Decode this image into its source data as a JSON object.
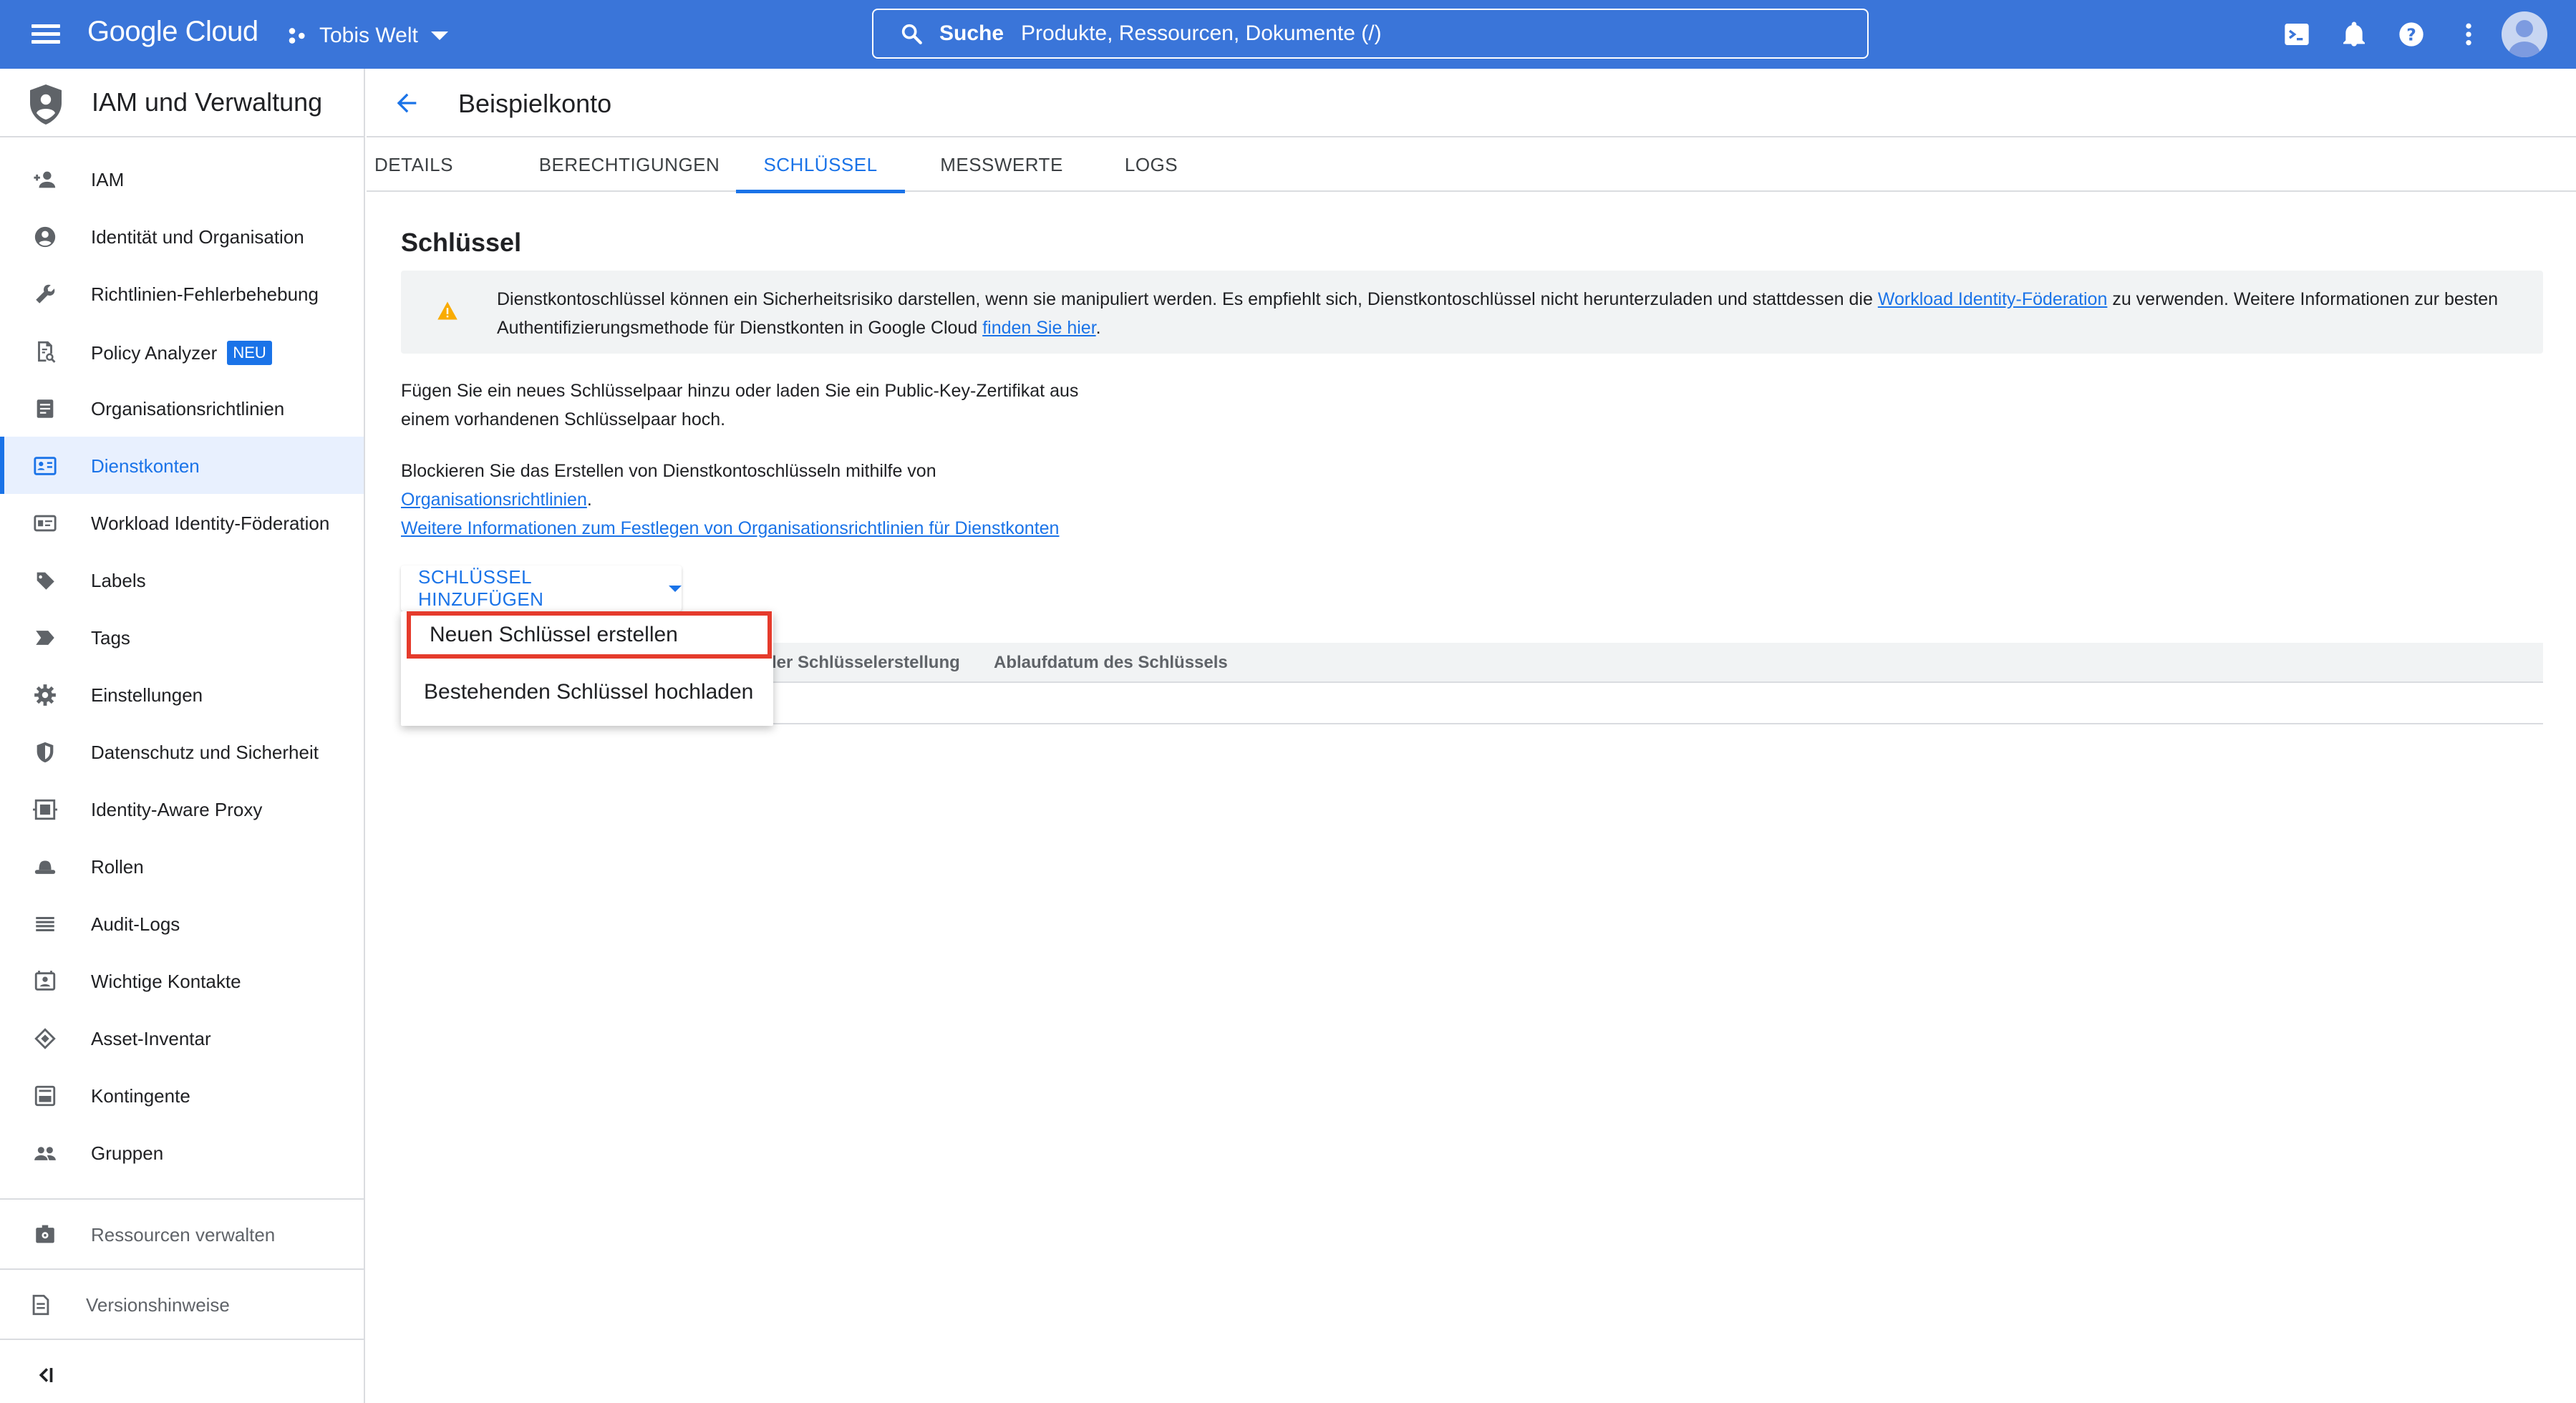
{
  "topbar": {
    "logo": "Google Cloud",
    "project": "Tobis Welt",
    "search_label": "Suche",
    "search_placeholder": "Produkte, Ressourcen, Dokumente (/)"
  },
  "sidebar": {
    "title": "IAM und Verwaltung",
    "items": [
      {
        "label": "IAM",
        "icon": "person-add-icon"
      },
      {
        "label": "Identität und Organisation",
        "icon": "account-circle-icon"
      },
      {
        "label": "Richtlinien-Fehlerbehebung",
        "icon": "wrench-icon"
      },
      {
        "label": "Policy Analyzer",
        "icon": "document-search-icon",
        "badge": "NEU"
      },
      {
        "label": "Organisationsrichtlinien",
        "icon": "list-document-icon"
      },
      {
        "label": "Dienstkonten",
        "icon": "service-account-icon",
        "active": true
      },
      {
        "label": "Workload Identity-Föderation",
        "icon": "id-card-icon"
      },
      {
        "label": "Labels",
        "icon": "label-icon"
      },
      {
        "label": "Tags",
        "icon": "tag-arrow-icon"
      },
      {
        "label": "Einstellungen",
        "icon": "gear-icon"
      },
      {
        "label": "Datenschutz und Sicherheit",
        "icon": "shield-icon"
      },
      {
        "label": "Identity-Aware Proxy",
        "icon": "proxy-icon"
      },
      {
        "label": "Rollen",
        "icon": "hat-icon"
      },
      {
        "label": "Audit-Logs",
        "icon": "lines-icon"
      },
      {
        "label": "Wichtige Kontakte",
        "icon": "contact-card-icon"
      },
      {
        "label": "Asset-Inventar",
        "icon": "layers-icon"
      },
      {
        "label": "Kontingente",
        "icon": "quota-icon"
      },
      {
        "label": "Gruppen",
        "icon": "group-icon"
      }
    ],
    "bottom": {
      "manage_resources": "Ressourcen verwalten",
      "release_notes": "Versionshinweise"
    }
  },
  "header": {
    "title": "Beispielkonto"
  },
  "tabs": [
    "DETAILS",
    "BERECHTIGUNGEN",
    "SCHLÜSSEL",
    "MESSWERTE",
    "LOGS"
  ],
  "active_tab": "SCHLÜSSEL",
  "keys": {
    "title": "Schlüssel",
    "warning_pre": "Dienstkontoschlüssel können ein Sicherheitsrisiko darstellen, wenn sie manipuliert werden. Es empfiehlt sich, Dienstkontoschlüssel nicht herunterzuladen und stattdessen die ",
    "warning_link1": "Workload Identity-Föderation",
    "warning_mid": " zu verwenden. Weitere Informationen zur besten Authentifizierungsmethode für Dienstkonten in Google Cloud ",
    "warning_link2": "finden Sie hier",
    "warning_post": ".",
    "para1_line1": "Fügen Sie ein neues Schlüsselpaar hinzu oder laden Sie ein Public-Key-Zertifikat aus",
    "para1_line2": "einem vorhandenen Schlüsselpaar hoch.",
    "para2_line1": "Blockieren Sie das Erstellen von Dienstkontoschlüsseln mithilfe von",
    "para2_link": "Organisationsrichtlinien",
    "para2_after": ".",
    "para2_link2": "Weitere Informationen zum Festlegen von Organisationsrichtlinien für Dienstkonten",
    "add_button": "SCHLÜSSEL HINZUFÜGEN",
    "table_headers": [
      "der Schlüsselerstellung",
      "Ablaufdatum des Schlüssels"
    ],
    "menu": [
      "Neuen Schlüssel erstellen",
      "Bestehenden Schlüssel hochladen"
    ]
  }
}
